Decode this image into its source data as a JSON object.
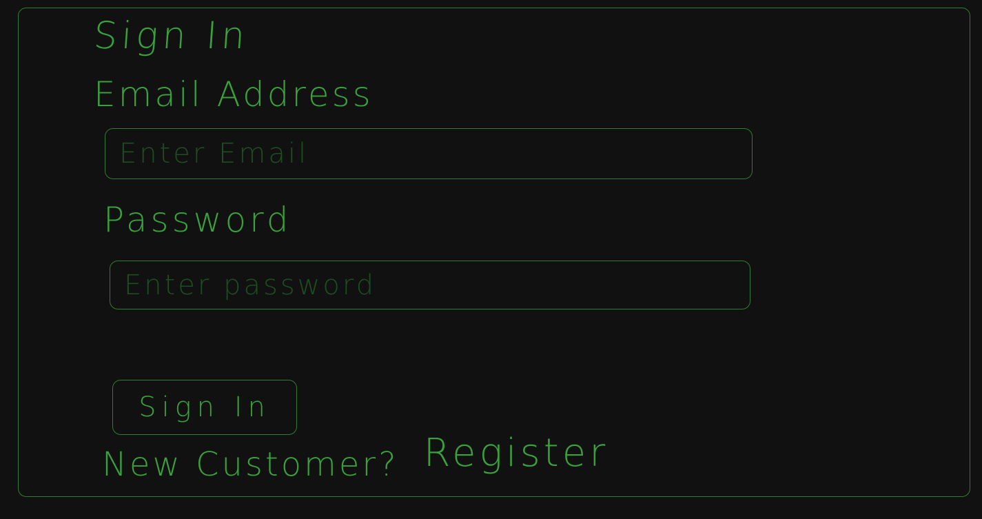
{
  "signin_form": {
    "title": "Sign In",
    "email_label": "Email Address",
    "email_placeholder": "Enter Email",
    "password_label": "Password",
    "password_placeholder": "Enter password",
    "submit_label": "Sign In",
    "new_customer_text": "New Customer?",
    "register_link": "Register"
  },
  "colors": {
    "background": "#111111",
    "stroke": "#39a23c",
    "border": "#2f7d32",
    "placeholder": "#1f4d22"
  }
}
